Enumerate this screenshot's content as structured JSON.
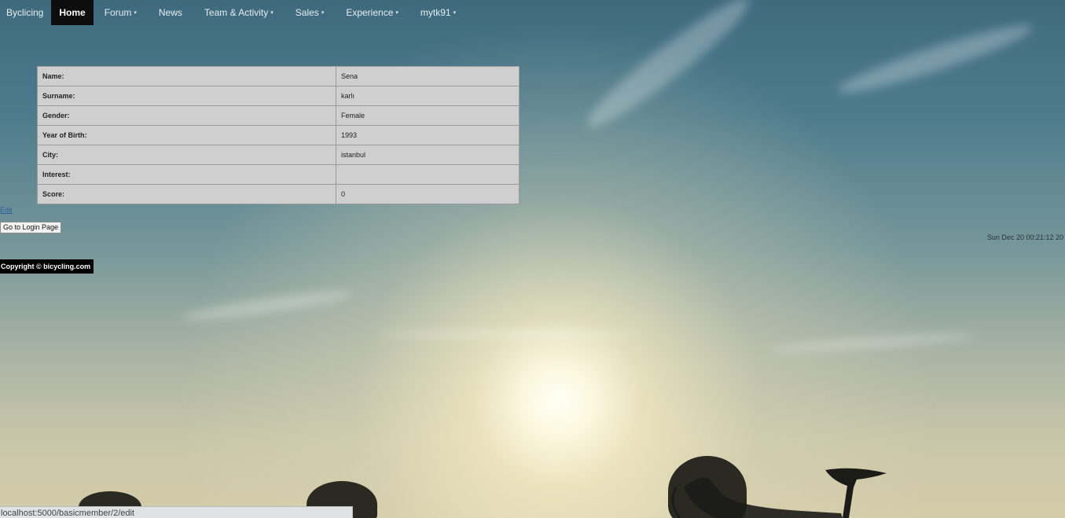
{
  "navbar": {
    "brand": "Byclicing",
    "items": [
      {
        "label": "Home",
        "dropdown": false,
        "active": true
      },
      {
        "label": "Forum",
        "dropdown": true,
        "active": false
      },
      {
        "label": "News",
        "dropdown": false,
        "active": false
      },
      {
        "label": "Team & Activity",
        "dropdown": true,
        "active": false
      },
      {
        "label": "Sales",
        "dropdown": true,
        "active": false
      },
      {
        "label": "Experience",
        "dropdown": true,
        "active": false
      },
      {
        "label": "mytk91",
        "dropdown": true,
        "active": false
      }
    ],
    "caret_icon": "caret-down-icon"
  },
  "profile": {
    "rows": [
      {
        "label": "Name:",
        "value": "Sena"
      },
      {
        "label": "Surname:",
        "value": "karlı"
      },
      {
        "label": "Gender:",
        "value": "Female"
      },
      {
        "label": "Year of Birth:",
        "value": "1993"
      },
      {
        "label": "City:",
        "value": "istanbul"
      },
      {
        "label": "Interest:",
        "value": ""
      },
      {
        "label": "Score:",
        "value": "0"
      }
    ]
  },
  "edit_link": "Edit",
  "login_button": "Go to Login Page",
  "clock": "Sun Dec 20 00:21:12 20",
  "copyright": "Copyright © bicycling.com",
  "status_url": "localhost:5000/basicmember/2/edit",
  "colors": {
    "nav_active_bg": "#0d0d0d",
    "table_bg": "#cfcfcf",
    "sky_top": "#3f6a7e",
    "sky_bottom": "#d4cca9"
  }
}
